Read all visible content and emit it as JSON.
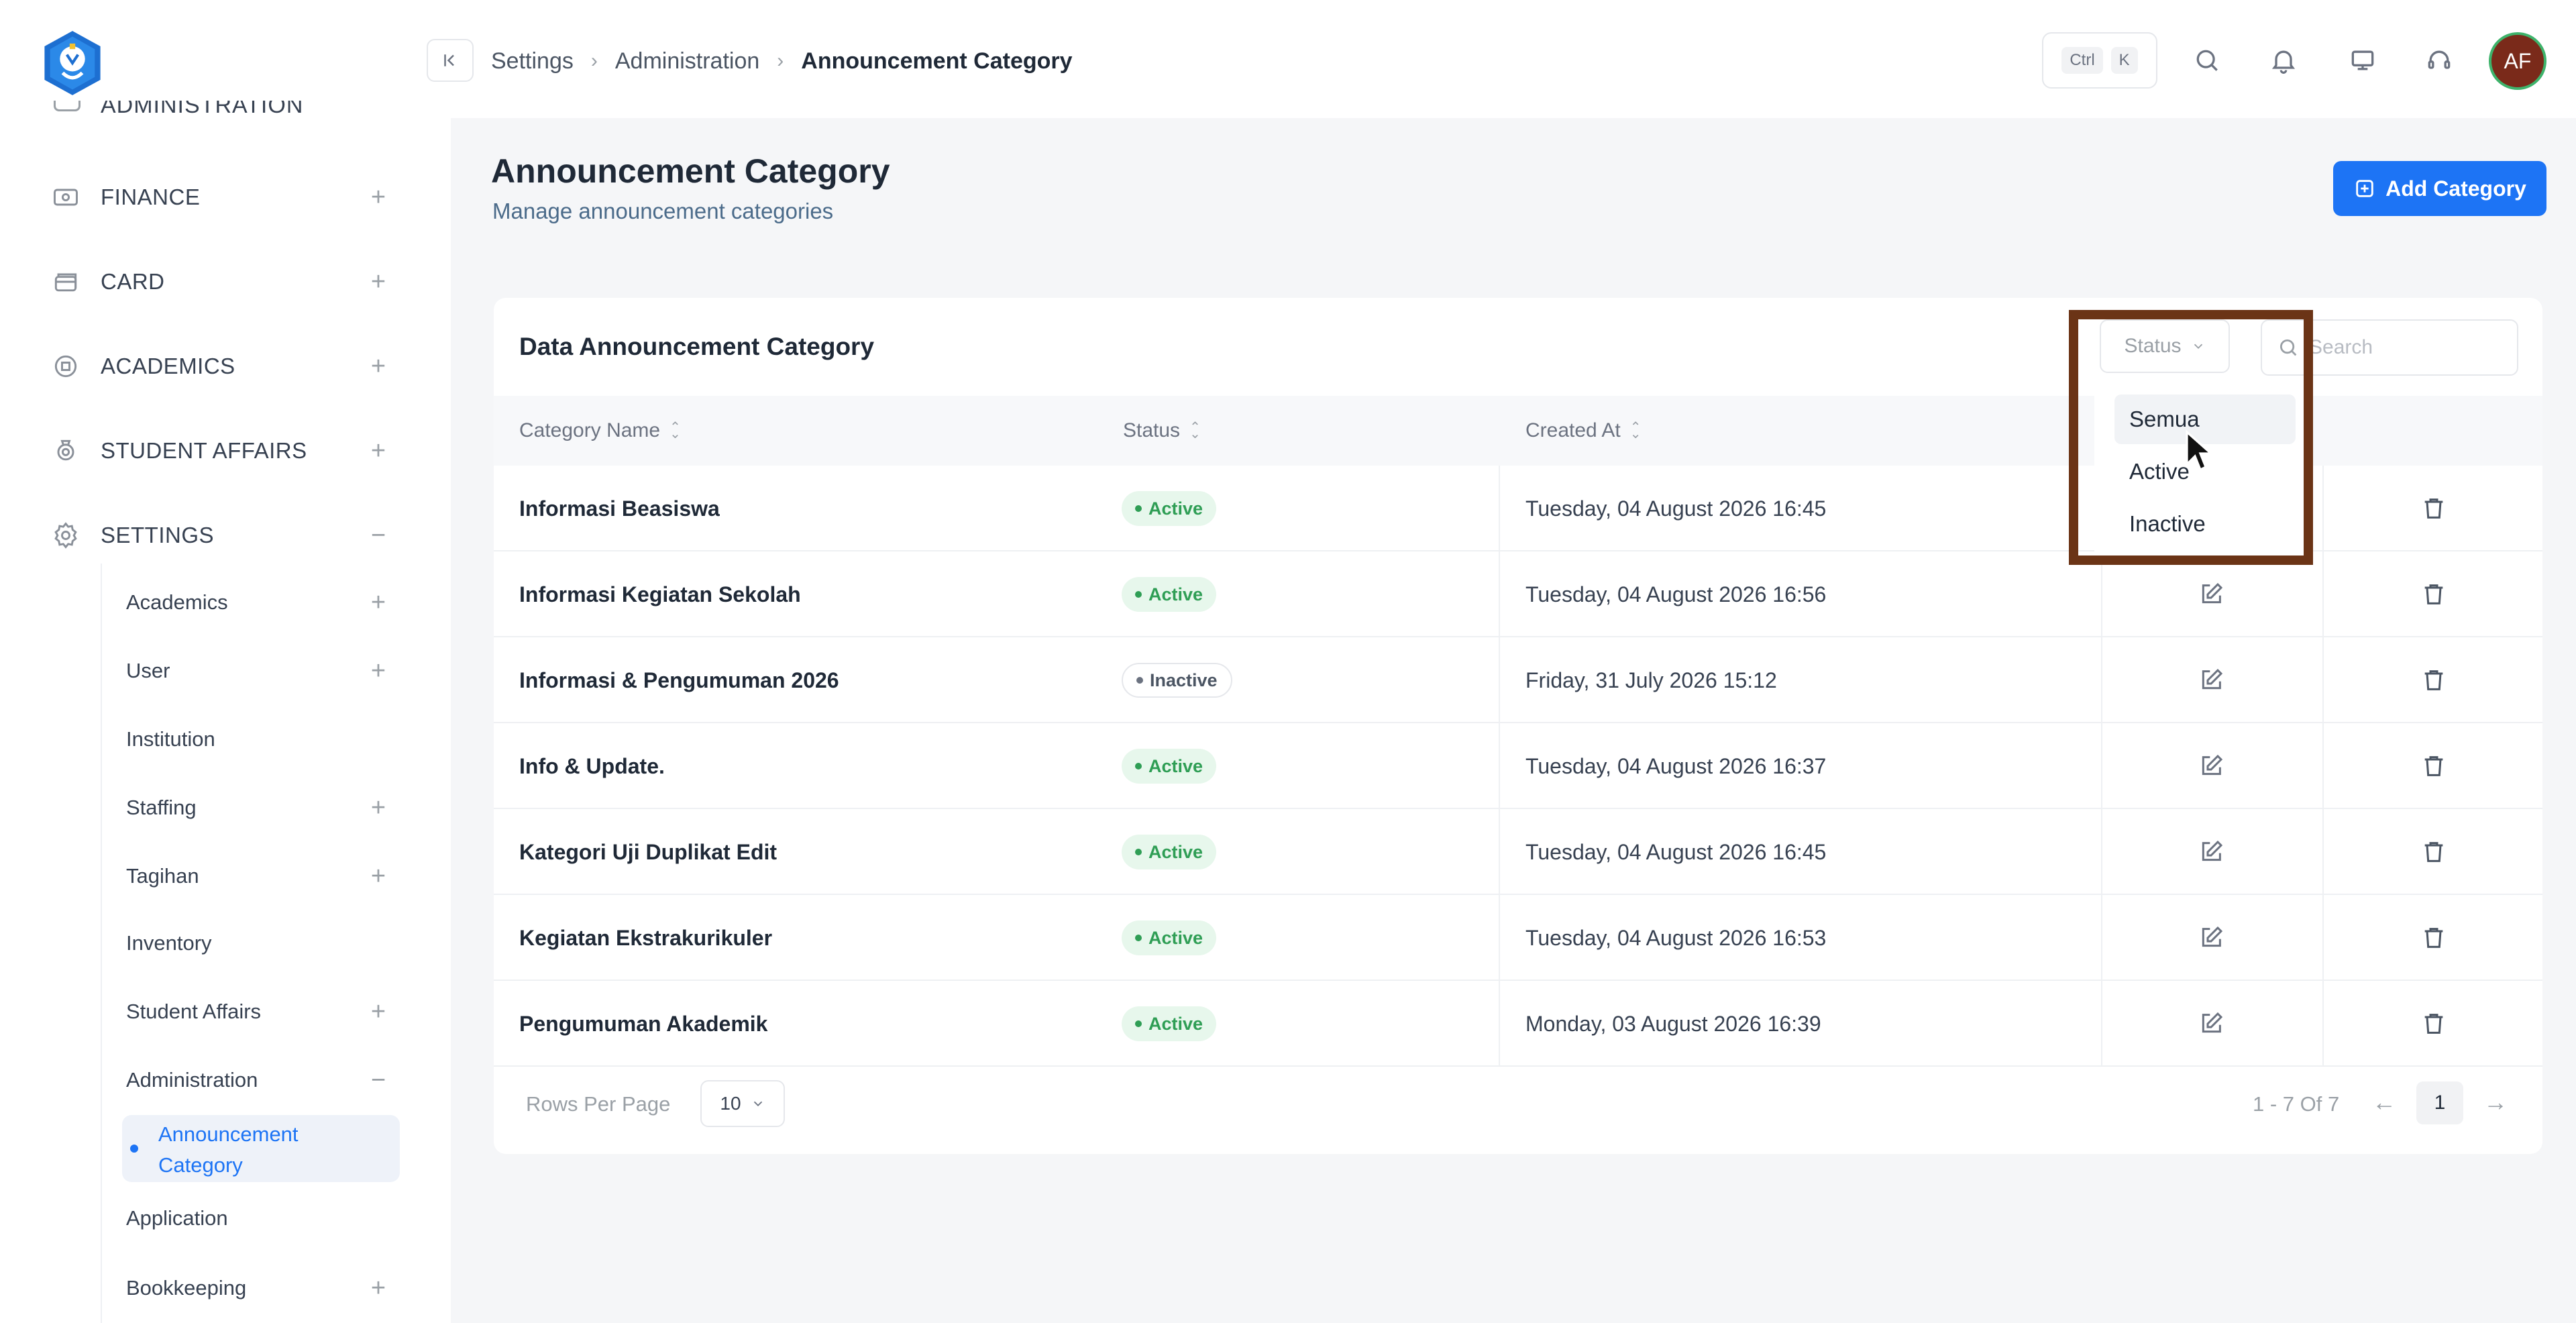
{
  "sidebar": {
    "cut_item": "ADMINISTRATION",
    "items": [
      {
        "label": "FINANCE",
        "toggle": "+",
        "icon": "finance-icon"
      },
      {
        "label": "CARD",
        "toggle": "+",
        "icon": "card-icon"
      },
      {
        "label": "ACADEMICS",
        "toggle": "+",
        "icon": "academics-icon"
      },
      {
        "label": "STUDENT AFFAIRS",
        "toggle": "+",
        "icon": "student-affairs-icon"
      },
      {
        "label": "SETTINGS",
        "toggle": "−",
        "icon": "gear-icon"
      }
    ],
    "sub_items": [
      {
        "label": "Academics",
        "toggle": "+"
      },
      {
        "label": "User",
        "toggle": "+"
      },
      {
        "label": "Institution",
        "toggle": ""
      },
      {
        "label": "Staffing",
        "toggle": "+"
      },
      {
        "label": "Tagihan",
        "toggle": "+"
      },
      {
        "label": "Inventory",
        "toggle": ""
      },
      {
        "label": "Student Affairs",
        "toggle": "+"
      },
      {
        "label": "Administration",
        "toggle": "−"
      },
      {
        "label": "Application",
        "toggle": ""
      },
      {
        "label": "Bookkeeping",
        "toggle": "+"
      }
    ],
    "active_sub": "Announcement Category"
  },
  "topbar": {
    "breadcrumb": [
      "Settings",
      "Administration",
      "Announcement Category"
    ],
    "kbd": [
      "Ctrl",
      "K"
    ],
    "avatar_initials": "AF"
  },
  "page": {
    "title": "Announcement Category",
    "subtitle": "Manage announcement categories",
    "add_button": "Add Category"
  },
  "card": {
    "title": "Data Announcement Category",
    "status_filter_label": "Status",
    "search_placeholder": "Search",
    "columns": [
      "Category Name",
      "Status",
      "Created At"
    ],
    "rows": [
      {
        "name": "Informasi Beasiswa",
        "status": "Active",
        "created_at": "Tuesday, 04 August 2026 16:45"
      },
      {
        "name": "Informasi Kegiatan Sekolah",
        "status": "Active",
        "created_at": "Tuesday, 04 August 2026 16:56"
      },
      {
        "name": "Informasi & Pengumuman 2026",
        "status": "Inactive",
        "created_at": "Friday, 31 July 2026 15:12"
      },
      {
        "name": "Info & Update.",
        "status": "Active",
        "created_at": "Tuesday, 04 August 2026 16:37"
      },
      {
        "name": "Kategori Uji Duplikat Edit",
        "status": "Active",
        "created_at": "Tuesday, 04 August 2026 16:45"
      },
      {
        "name": "Kegiatan Ekstrakurikuler",
        "status": "Active",
        "created_at": "Tuesday, 04 August 2026 16:53"
      },
      {
        "name": "Pengumuman Akademik",
        "status": "Active",
        "created_at": "Monday, 03 August 2026 16:39"
      }
    ],
    "pagination": {
      "rows_per_page_label": "Rows Per Page",
      "rows_per_page": "10",
      "range": "1 - 7 Of 7",
      "current_page": "1",
      "prev": "←",
      "next": "→"
    }
  },
  "status_dropdown": {
    "options": [
      "Semua",
      "Active",
      "Inactive"
    ],
    "hovered": "Semua"
  },
  "colors": {
    "accent": "#1d74f5",
    "active_badge_bg": "#e7f7ec",
    "active_badge_text": "#2f9e55",
    "highlight_border": "#6b3416",
    "avatar_bg": "#7a2a1a"
  }
}
